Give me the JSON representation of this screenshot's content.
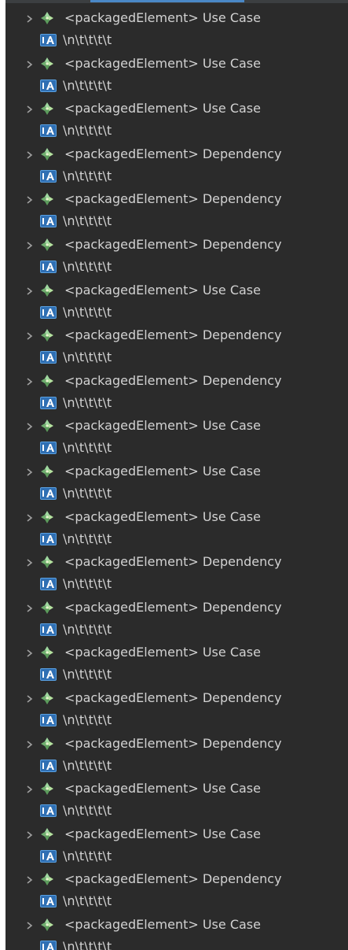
{
  "colors": {
    "background": "#2b2b2b",
    "text": "#d2d2d2",
    "element_icon": "#8fc98f",
    "text_icon": "#4a88c7",
    "chevron": "#a0a0a0"
  },
  "icons": {
    "expand": "chevron-right-icon",
    "element": "uml-element-icon",
    "text": "text-attribute-icon"
  },
  "tree": {
    "items": [
      {
        "label": "<packagedElement> Use Case",
        "text": "\\n\\t\\t\\t\\t"
      },
      {
        "label": "<packagedElement> Use Case",
        "text": "\\n\\t\\t\\t\\t"
      },
      {
        "label": "<packagedElement> Use Case",
        "text": "\\n\\t\\t\\t\\t"
      },
      {
        "label": "<packagedElement> Dependency",
        "text": "\\n\\t\\t\\t\\t"
      },
      {
        "label": "<packagedElement> Dependency",
        "text": "\\n\\t\\t\\t\\t"
      },
      {
        "label": "<packagedElement> Dependency",
        "text": "\\n\\t\\t\\t\\t"
      },
      {
        "label": "<packagedElement> Use Case",
        "text": "\\n\\t\\t\\t\\t"
      },
      {
        "label": "<packagedElement> Dependency",
        "text": "\\n\\t\\t\\t\\t"
      },
      {
        "label": "<packagedElement> Dependency",
        "text": "\\n\\t\\t\\t\\t"
      },
      {
        "label": "<packagedElement> Use Case",
        "text": "\\n\\t\\t\\t\\t"
      },
      {
        "label": "<packagedElement> Use Case",
        "text": "\\n\\t\\t\\t\\t"
      },
      {
        "label": "<packagedElement> Use Case",
        "text": "\\n\\t\\t\\t\\t"
      },
      {
        "label": "<packagedElement> Dependency",
        "text": "\\n\\t\\t\\t\\t"
      },
      {
        "label": "<packagedElement> Dependency",
        "text": "\\n\\t\\t\\t\\t"
      },
      {
        "label": "<packagedElement> Use Case",
        "text": "\\n\\t\\t\\t\\t"
      },
      {
        "label": "<packagedElement> Dependency",
        "text": "\\n\\t\\t\\t\\t"
      },
      {
        "label": "<packagedElement> Dependency",
        "text": "\\n\\t\\t\\t\\t"
      },
      {
        "label": "<packagedElement> Use Case",
        "text": "\\n\\t\\t\\t\\t"
      },
      {
        "label": "<packagedElement> Use Case",
        "text": "\\n\\t\\t\\t\\t"
      },
      {
        "label": "<packagedElement> Dependency",
        "text": "\\n\\t\\t\\t\\t"
      },
      {
        "label": "<packagedElement> Use Case",
        "text": "\\n\\t\\t\\t\\t"
      }
    ]
  }
}
